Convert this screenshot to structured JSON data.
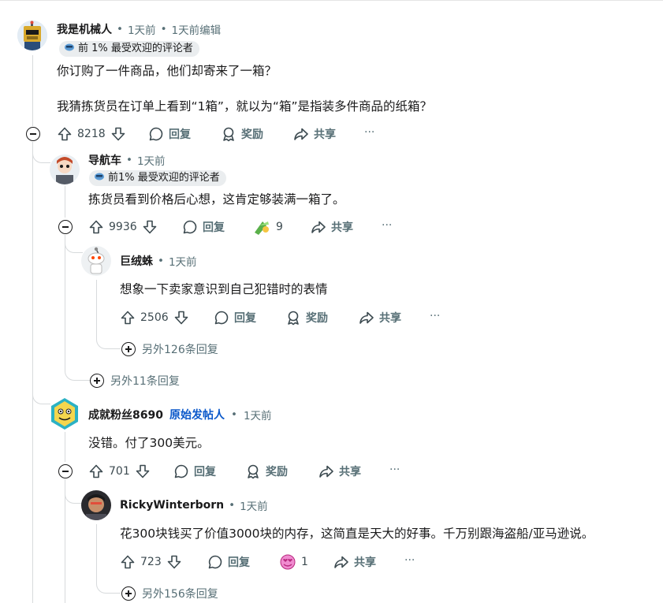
{
  "comments": [
    {
      "username": "我是机械人",
      "time": "1天前",
      "edited": "1天前编辑",
      "flair": "前 1% 最受欢迎的评论者",
      "body_lines": [
        "你订购了一件商品，他们却寄来了一箱？",
        "我猜拣货员在订单上看到“1箱”，就以为“箱”是指装多件商品的纸箱？"
      ],
      "votes": "8218",
      "reply": "回复",
      "award": "奖励",
      "share": "共享",
      "more": "···"
    },
    {
      "username": "导航车",
      "time": "1天前",
      "flair": "前1% 最受欢迎的评论者",
      "body": "拣货员看到价格后心想，这肯定够装满一箱了。",
      "votes": "9936",
      "reply": "回复",
      "award_count": "9",
      "share": "共享",
      "more": "···"
    },
    {
      "username": "巨绒蛛",
      "time": "1天前",
      "body": "想象一下卖家意识到自己犯错时的表情",
      "votes": "2506",
      "reply": "回复",
      "award": "奖励",
      "share": "共享",
      "more": "···",
      "more_replies": "另外126条回复"
    },
    {
      "more_replies": "另外11条回复"
    },
    {
      "username": "成就粉丝8690",
      "op_label": "原始发帖人",
      "time": "1天前",
      "body": "没错。付了300美元。",
      "votes": "701",
      "reply": "回复",
      "award": "奖励",
      "share": "共享",
      "more": "···"
    },
    {
      "username": "RickyWinterborn",
      "time": "1天前",
      "body": "花300块钱买了价值3000块的内存，这简直是天大的好事。千万别跟海盗船/亚马逊说。",
      "votes": "723",
      "reply": "回复",
      "award_count": "1",
      "share": "共享",
      "more": "···",
      "more_replies": "另外156条回复"
    }
  ],
  "sep": "•",
  "colors": {
    "text": "#1a1a1b",
    "muted": "#576f76",
    "op": "#0a58ca",
    "thread": "#d7dadc"
  },
  "icons": [
    "upvote-icon",
    "downvote-icon",
    "comment-icon",
    "award-icon",
    "share-icon",
    "collapse-icon",
    "expand-icon"
  ]
}
